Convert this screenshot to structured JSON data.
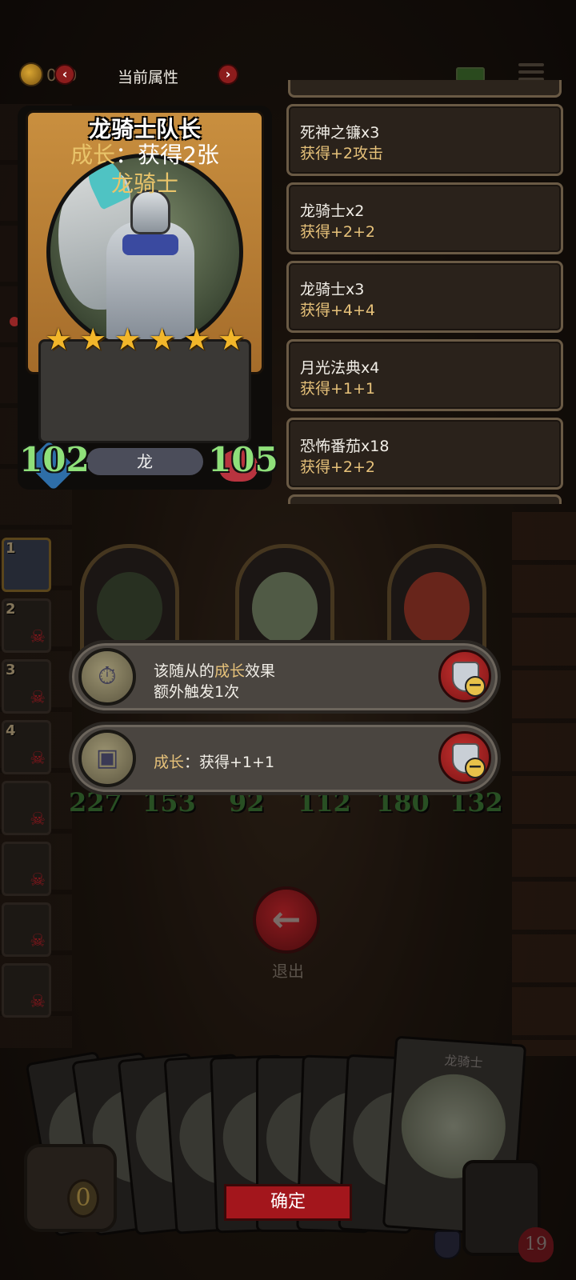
{
  "topbar": {
    "coin_count": "020",
    "title": "当前属性",
    "prev_icon": "chevron-left-icon",
    "next_icon": "chevron-right-icon",
    "prev_label": "‹",
    "next_label": "›"
  },
  "hero": {
    "name": "龙骑士队长",
    "stars": 6,
    "desc_keyword": "成长",
    "desc_rest": "：获得2张",
    "desc_line2": "龙骑士",
    "attack": "102",
    "health": "105",
    "tribe": "龙"
  },
  "attributes": [
    {
      "name": "死神之镰x3",
      "effect": "获得+2攻击"
    },
    {
      "name": "龙骑士x2",
      "effect": "获得+2+2"
    },
    {
      "name": "龙骑士x3",
      "effect": "获得+4+4"
    },
    {
      "name": "月光法典x4",
      "effect": "获得+1+1"
    },
    {
      "name": "恐怖番茄x18",
      "effect": "获得+2+2"
    }
  ],
  "side_cards": [
    {
      "num": "1",
      "dead": false
    },
    {
      "num": "2",
      "dead": true
    },
    {
      "num": "3",
      "dead": true
    },
    {
      "num": "4",
      "dead": true
    },
    {
      "num": "",
      "dead": true
    },
    {
      "num": "",
      "dead": true
    },
    {
      "num": "",
      "dead": true
    },
    {
      "num": "",
      "dead": true
    }
  ],
  "minions": [
    {
      "attack": "227",
      "health": "153"
    },
    {
      "attack": "92",
      "health": "112"
    },
    {
      "attack": "180",
      "health": "132"
    }
  ],
  "effects": [
    {
      "pre": "该随从的",
      "keyword": "成长",
      "post": "效果",
      "line2": "额外触发1次"
    },
    {
      "keyword": "成长",
      "rest": "：获得+1+1"
    }
  ],
  "exit_label": "退出",
  "hand_big_title": "龙骑士",
  "chest_count": "0",
  "confirm_label": "确定",
  "player_hp": "19",
  "skull_glyph": "☠",
  "star_glyph": "★",
  "exit_arrow": "←",
  "minus_glyph": "−"
}
